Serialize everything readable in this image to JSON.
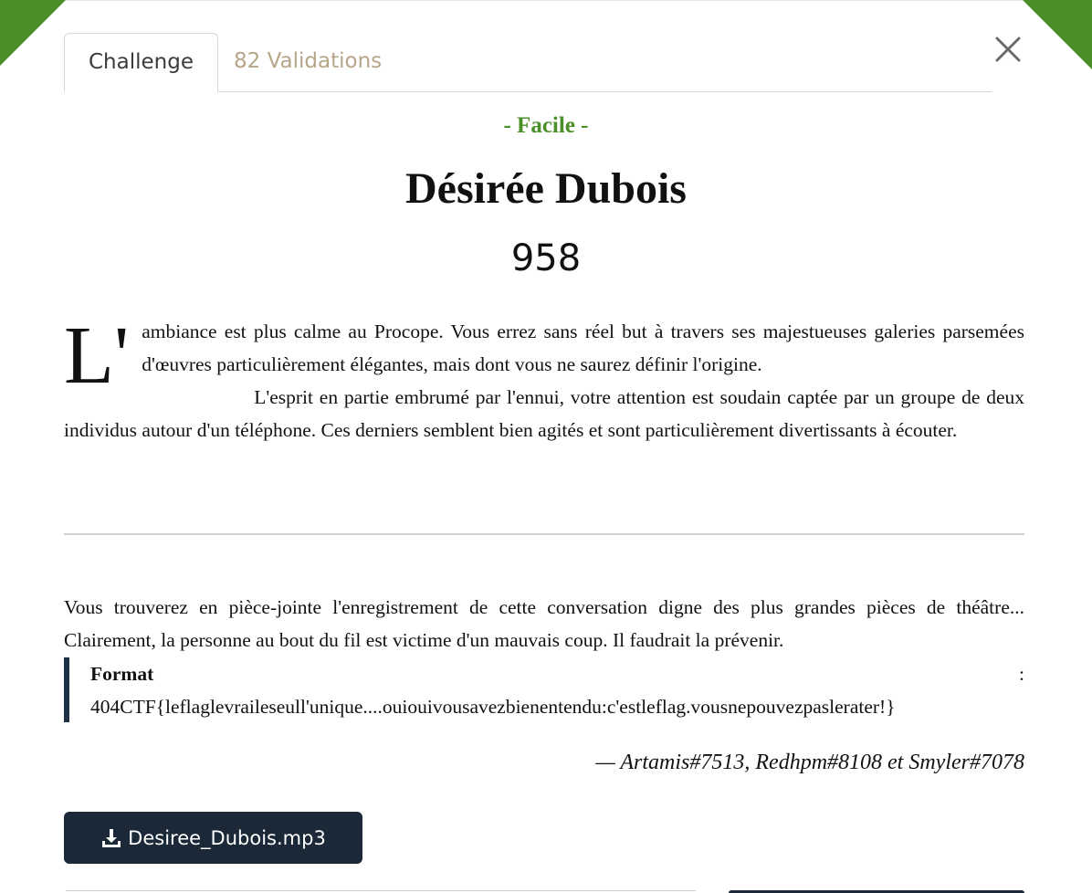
{
  "tabs": [
    {
      "label": "Challenge"
    },
    {
      "label": "82 Validations"
    }
  ],
  "challenge": {
    "difficulty": "- Facile -",
    "title": "Désirée Dubois",
    "points": "958"
  },
  "story": {
    "dropcap": "L'",
    "paragraph1": "ambiance est plus calme au Procope. Vous errez sans réel but à travers ses majestueuses galeries parsemées d'œuvres particulièrement élégantes, mais dont vous ne saurez définir l'origine.",
    "paragraph2": "L'esprit en partie embrumé par l'ennui, votre attention est soudain captée par un groupe de deux individus autour d'un téléphone. Ces derniers semblent bien agités et sont particulièrement divertissants à écouter."
  },
  "description": "Vous trouverez en pièce-jointe l'enregistrement de cette conversation digne des plus grandes pièces de théâtre... Clairement, la personne au bout du fil est victime d'un mauvais coup. Il faudrait la prévenir.",
  "format": {
    "label": "Format",
    "colon": ":",
    "example": "404CTF{leflaglevraileseull'unique....ouiouivousavezbienentendu:c'estleflag.vousnepouvezpaslerater!}"
  },
  "authors": "— Artamis#7513, Redhpm#8108 et Smyler#7078",
  "download": {
    "label": "Desiree_Dubois.mp3",
    "icon": "download-icon"
  },
  "colors": {
    "accent": "#4a8f27",
    "button": "#1b2838",
    "inactive_tab": "#b7a58a"
  }
}
